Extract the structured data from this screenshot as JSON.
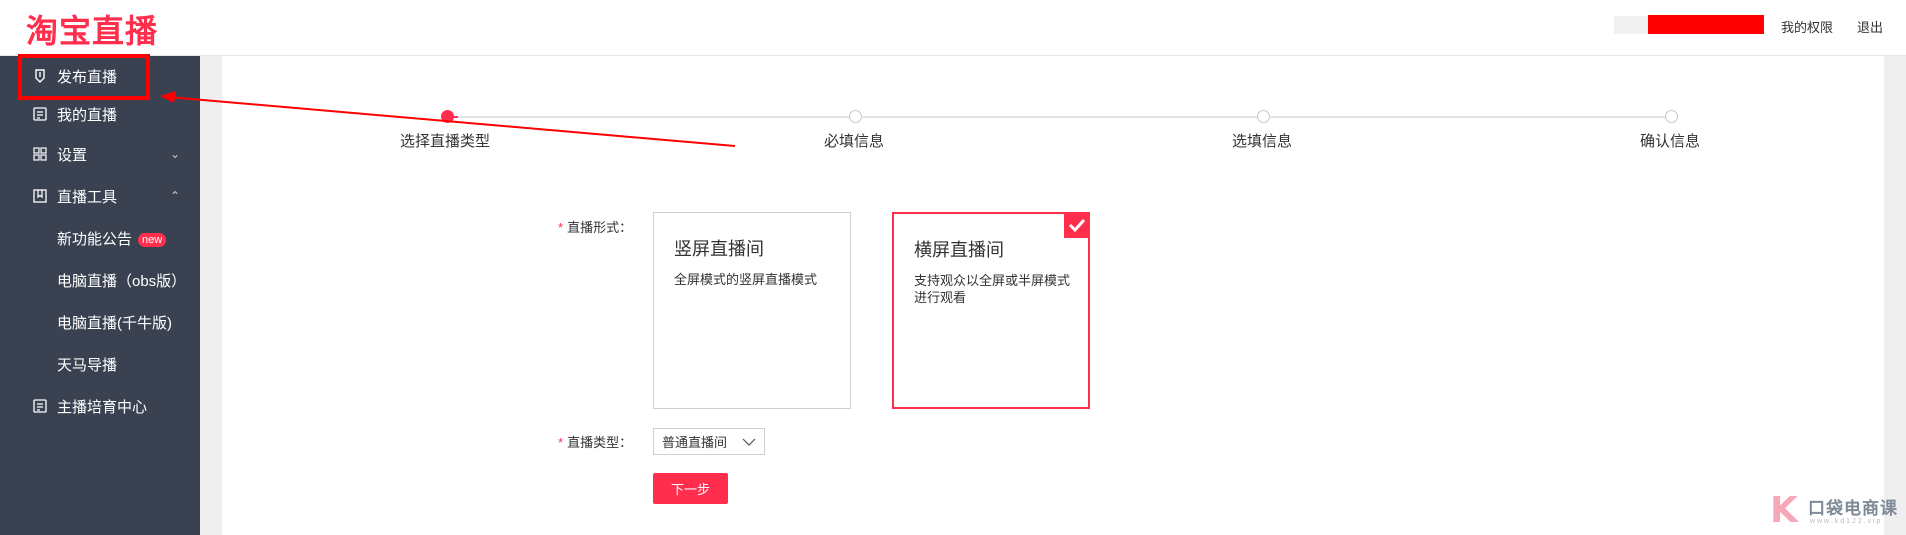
{
  "header": {
    "logo": "淘宝直播",
    "my_permission": "我的权限",
    "logout": "退出"
  },
  "sidebar": {
    "items": [
      {
        "label": "发布直播",
        "icon": "publish-icon"
      },
      {
        "label": "我的直播",
        "icon": "document-icon"
      },
      {
        "label": "设置",
        "icon": "grid-icon",
        "chevron": "⌄"
      },
      {
        "label": "直播工具",
        "icon": "book-icon",
        "chevron": "⌃"
      },
      {
        "label": "新功能公告",
        "badge": "new"
      },
      {
        "label": "电脑直播（obs版）"
      },
      {
        "label": "电脑直播(千牛版)"
      },
      {
        "label": "天马导播"
      },
      {
        "label": "主播培育中心",
        "icon": "document-icon"
      }
    ]
  },
  "steps": [
    {
      "label": "选择直播类型",
      "active": true
    },
    {
      "label": "必填信息",
      "active": false
    },
    {
      "label": "选填信息",
      "active": false
    },
    {
      "label": "确认信息",
      "active": false
    }
  ],
  "form": {
    "format_label": "直播形式：",
    "type_label": "直播类型：",
    "required_mark": "*",
    "cards": [
      {
        "title": "竖屏直播间",
        "desc": "全屏模式的竖屏直播模式",
        "selected": false
      },
      {
        "title": "横屏直播间",
        "desc": "支持观众以全屏或半屏模式进行观看",
        "selected": true
      }
    ],
    "type_select_value": "普通直播间",
    "next_button": "下一步"
  },
  "watermark": {
    "text": "口袋电商课",
    "url": "w w w . k d 1 2 2 . v i p"
  },
  "colors": {
    "brand": "#ff2e4d",
    "sidebar_bg": "#3a4252",
    "annotation": "#ff0000"
  }
}
